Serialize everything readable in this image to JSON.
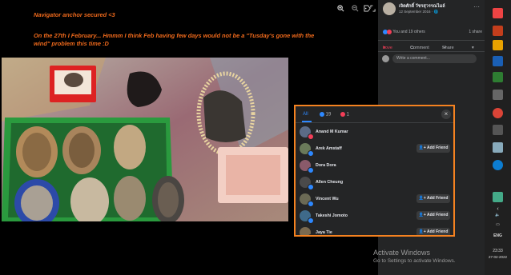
{
  "post": {
    "line1": "Navigator anchor secured <3",
    "line2": "On the 27th I February... Hmmm I think Feb having few days would not be a \"Tusday's gone with the",
    "line3": "wind\" problem this time :D"
  },
  "viewer_tools": [
    "zoom-in-icon",
    "zoom-out-icon",
    "tag-icon",
    "fullscreen-icon"
  ],
  "sidebar": {
    "user_name": "เจิดศักดิ์ วัชรสุวรรณไมล์",
    "date": "12 September 2016 · 🌐",
    "reactions_summary": "You and 19 others",
    "share_count": "1 share",
    "love_label": "Love",
    "comment_label": "Comment",
    "share_label": "Share",
    "write_placeholder": "Write a comment..."
  },
  "modal": {
    "tab_all": "All",
    "tab_like": "19",
    "tab_love": "1",
    "people": [
      {
        "name": "Anand M Kumar",
        "reaction": "love",
        "add": false,
        "avatar": "#5b6b86"
      },
      {
        "name": "Arek Amstaff",
        "reaction": "like",
        "add": true,
        "avatar": "#6a7a5a"
      },
      {
        "name": "Dora Dora",
        "reaction": "like",
        "add": false,
        "avatar": "#8a5a6a"
      },
      {
        "name": "Allen Cheung",
        "reaction": "like",
        "add": false,
        "avatar": "#4a4a4a"
      },
      {
        "name": "Vincent Wu",
        "reaction": "like",
        "add": true,
        "avatar": "#6b6a55"
      },
      {
        "name": "Takeshi Jomoto",
        "reaction": "like",
        "add": true,
        "avatar": "#3f6a8a"
      },
      {
        "name": "Jaya Tie",
        "reaction": "like",
        "add": true,
        "avatar": "#7a6a50"
      }
    ],
    "add_friend_label": "Add Friend"
  },
  "taskbar": {
    "language": "ENG",
    "time": "23:33",
    "date": "27-02-2022"
  },
  "watermark": {
    "title": "Activate Windows",
    "subtitle": "Go to Settings to activate Windows."
  },
  "colors": {
    "post_text": "#f06a1c",
    "highlight_border": "#f58220",
    "like_blue": "#2d88ff",
    "love_red": "#f33e58"
  }
}
